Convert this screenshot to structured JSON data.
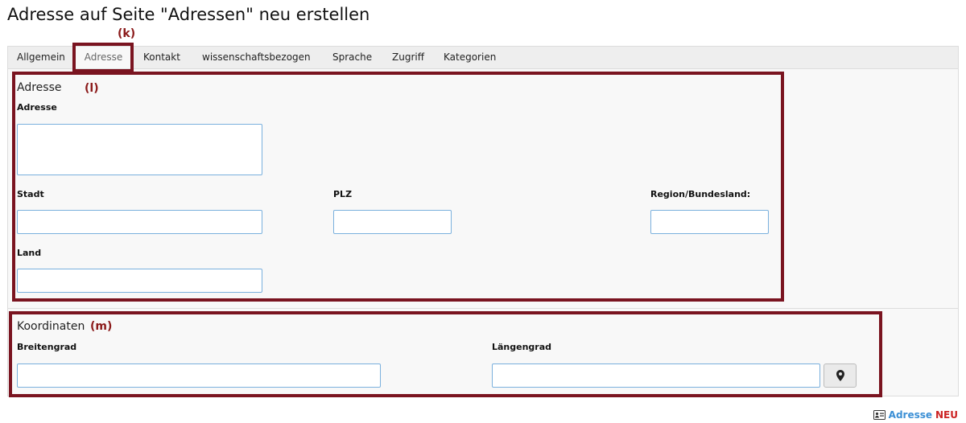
{
  "page": {
    "title": "Adresse auf Seite \"Adressen\" neu erstellen"
  },
  "tabs": [
    {
      "label": "Allgemein",
      "active": false
    },
    {
      "label": "Adresse",
      "active": true
    },
    {
      "label": "Kontakt",
      "active": false
    },
    {
      "label": "wissenschaftsbezogen",
      "active": false
    },
    {
      "label": "Sprache",
      "active": false
    },
    {
      "label": "Zugriff",
      "active": false
    },
    {
      "label": "Kategorien",
      "active": false
    }
  ],
  "annotations": {
    "k": "(k)",
    "l": "(l)",
    "m": "(m)",
    "color": "#7a1420"
  },
  "address_section": {
    "title": "Adresse",
    "fields": {
      "adresse": {
        "label": "Adresse",
        "value": ""
      },
      "stadt": {
        "label": "Stadt",
        "value": ""
      },
      "plz": {
        "label": "PLZ",
        "value": ""
      },
      "region": {
        "label": "Region/Bundesland:",
        "value": ""
      },
      "land": {
        "label": "Land",
        "value": ""
      }
    }
  },
  "coordinates_section": {
    "title": "Koordinaten",
    "fields": {
      "breitengrad": {
        "label": "Breitengrad",
        "value": ""
      },
      "laengengrad": {
        "label": "Längengrad",
        "value": ""
      }
    },
    "geo_button_icon": "map-marker-icon"
  },
  "footer": {
    "icon": "address-card-icon",
    "record_type": "Adresse",
    "status": "NEU"
  },
  "colors": {
    "input_border": "#7ab0dd",
    "footer_type": "#3b8fd5",
    "footer_status": "#cc2222"
  }
}
